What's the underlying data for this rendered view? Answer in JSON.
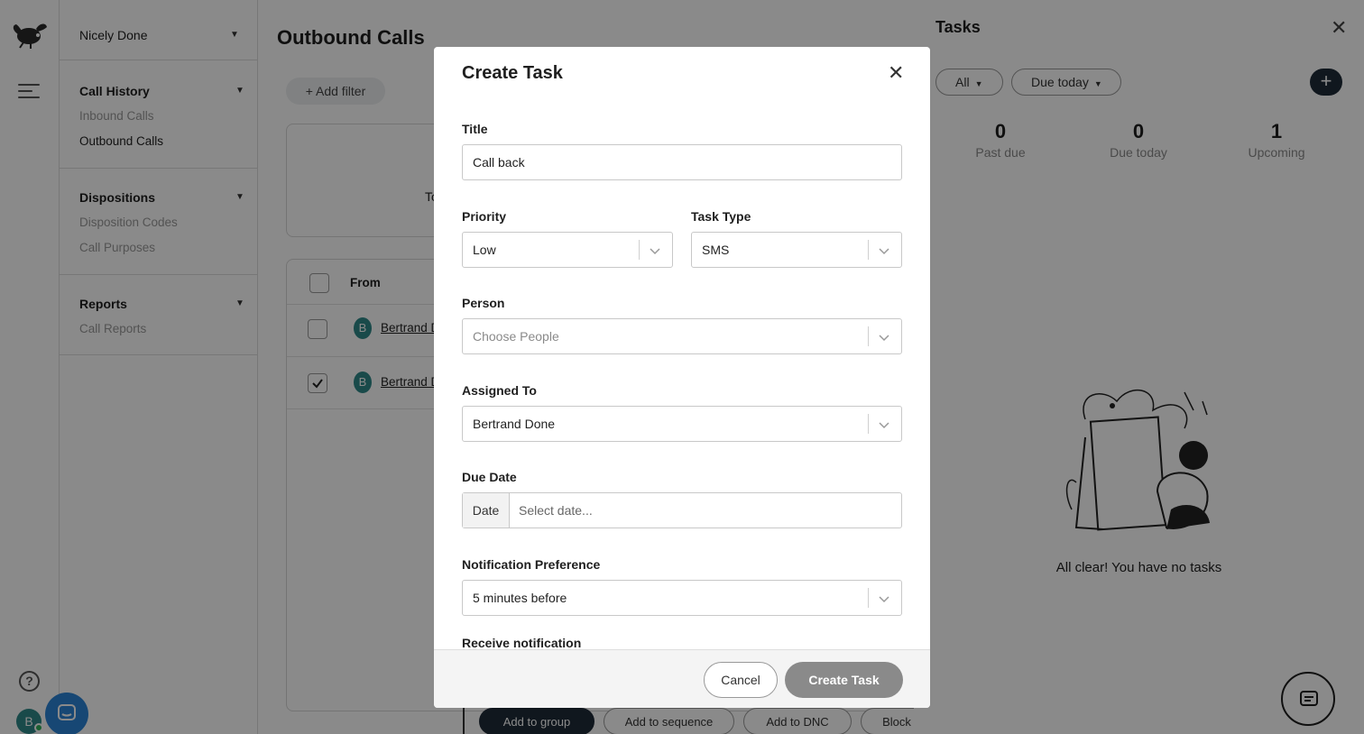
{
  "sidebar": {
    "user_name": "Nicely Done",
    "sections": [
      {
        "title": "Call History",
        "items": [
          {
            "label": "Inbound Calls",
            "active": false
          },
          {
            "label": "Outbound Calls",
            "active": true
          }
        ]
      },
      {
        "title": "Dispositions",
        "items": [
          {
            "label": "Disposition Codes",
            "active": false
          },
          {
            "label": "Call Purposes",
            "active": false
          }
        ]
      },
      {
        "title": "Reports",
        "items": [
          {
            "label": "Call Reports",
            "active": false
          }
        ]
      }
    ]
  },
  "rail": {
    "avatar_letter": "B",
    "help_label": "?"
  },
  "main": {
    "page_title": "Outbound Calls",
    "add_filter_label": "+ Add filter",
    "summary_text_fragment": "To",
    "table": {
      "column_from": "From",
      "rows": [
        {
          "avatar_letter": "B",
          "name": "Bertrand D",
          "checked": false
        },
        {
          "avatar_letter": "B",
          "name": "Bertrand D",
          "checked": true
        }
      ]
    },
    "bulk_actions": {
      "add_to_group": "Add to group",
      "add_to_sequence": "Add to sequence",
      "add_to_dnc": "Add to DNC",
      "block": "Block"
    }
  },
  "tasks_panel": {
    "title": "Tasks",
    "filter_all": "All",
    "filter_due": "Due today",
    "stats": [
      {
        "value": "0",
        "label": "Past due"
      },
      {
        "value": "0",
        "label": "Due today"
      },
      {
        "value": "1",
        "label": "Upcoming"
      }
    ],
    "empty_message": "All clear! You have no tasks"
  },
  "modal": {
    "title": "Create Task",
    "fields": {
      "title": {
        "label": "Title",
        "value": "Call back"
      },
      "priority": {
        "label": "Priority",
        "value": "Low"
      },
      "task_type": {
        "label": "Task Type",
        "value": "SMS"
      },
      "person": {
        "label": "Person",
        "placeholder": "Choose People"
      },
      "assigned_to": {
        "label": "Assigned To",
        "value": "Bertrand Done"
      },
      "due_date": {
        "label": "Due Date",
        "prefix": "Date",
        "placeholder": "Select date..."
      },
      "notification_preference": {
        "label": "Notification Preference",
        "value": "5 minutes before"
      },
      "receive_notification": {
        "label": "Receive notification"
      }
    },
    "cancel_label": "Cancel",
    "create_label": "Create Task"
  },
  "colors": {
    "primary_dark": "#1f2b38",
    "teal_avatar": "#2f8a8a",
    "chat_blue": "#2b84d6",
    "disabled_button": "#8a8a8a"
  }
}
